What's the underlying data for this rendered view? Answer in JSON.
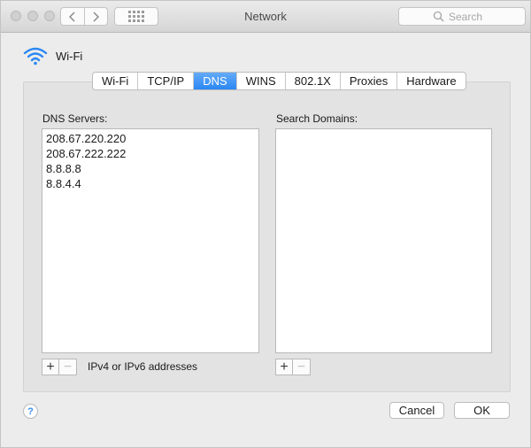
{
  "window": {
    "title": "Network"
  },
  "search": {
    "placeholder": "Search"
  },
  "header": {
    "interface_label": "Wi-Fi"
  },
  "tabs": [
    {
      "label": "Wi-Fi",
      "active": false
    },
    {
      "label": "TCP/IP",
      "active": false
    },
    {
      "label": "DNS",
      "active": true
    },
    {
      "label": "WINS",
      "active": false
    },
    {
      "label": "802.1X",
      "active": false
    },
    {
      "label": "Proxies",
      "active": false
    },
    {
      "label": "Hardware",
      "active": false
    }
  ],
  "dns": {
    "label": "DNS Servers:",
    "servers": [
      "208.67.220.220",
      "208.67.222.222",
      "8.8.8.8",
      "8.8.4.4"
    ],
    "hint": "IPv4 or IPv6 addresses"
  },
  "domains": {
    "label": "Search Domains:",
    "items": []
  },
  "buttons": {
    "cancel": "Cancel",
    "ok": "OK",
    "help": "?",
    "plus": "+",
    "minus": "−"
  },
  "colors": {
    "accent": "#2a87f3",
    "wifi_icon": "#2a87f3"
  }
}
